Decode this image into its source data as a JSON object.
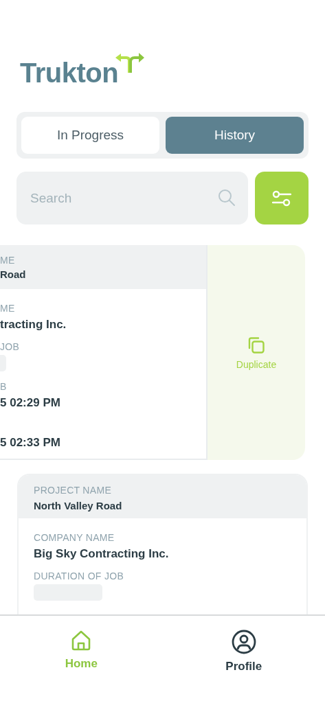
{
  "logo": {
    "text": "Trukton"
  },
  "tabs": [
    {
      "label": "In Progress",
      "selected": false
    },
    {
      "label": "History",
      "selected": true
    }
  ],
  "search": {
    "placeholder": "Search"
  },
  "swiped_card": {
    "header": {
      "label": "ME",
      "value": "Road"
    },
    "fields": [
      {
        "kind": "text",
        "label": "ME",
        "value": "tracting Inc."
      },
      {
        "kind": "badge",
        "label": "JOB"
      },
      {
        "kind": "text",
        "label": "B",
        "value": "5 02:29 PM"
      },
      {
        "kind": "text",
        "value": "5 02:33 PM"
      }
    ],
    "action": {
      "label": "Duplicate"
    }
  },
  "card": {
    "header": {
      "label": "PROJECT NAME",
      "value": "North Valley Road"
    },
    "fields": [
      {
        "kind": "text",
        "label": "COMPANY NAME",
        "value": "Big Sky Contracting Inc."
      },
      {
        "kind": "badge",
        "label": "DURATION OF JOB"
      }
    ]
  },
  "bottom_nav": [
    {
      "label": "Home",
      "kind": "home",
      "selected": true
    },
    {
      "label": "Profile",
      "kind": "profile",
      "selected": false
    }
  ]
}
